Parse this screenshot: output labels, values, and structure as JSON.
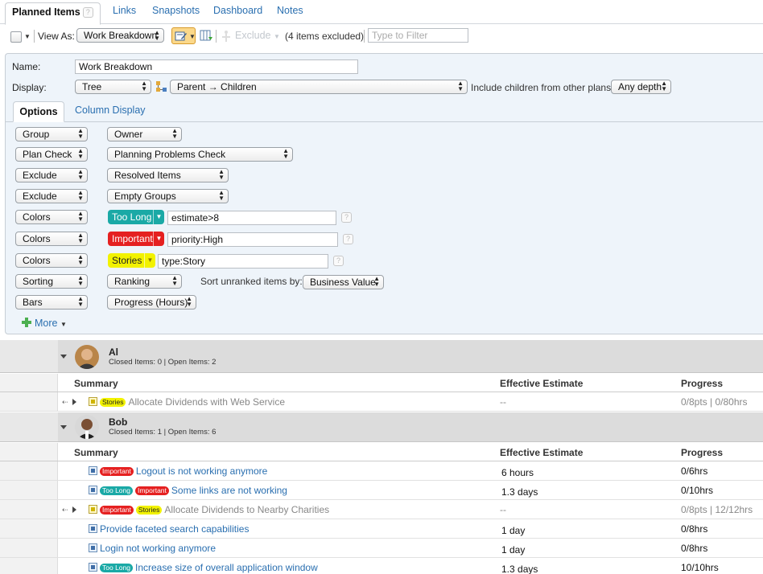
{
  "tabs": {
    "active": "Planned Items",
    "others": [
      "Links",
      "Snapshots",
      "Dashboard",
      "Notes"
    ]
  },
  "toolbar": {
    "view_as_label": "View As:",
    "view_as_value": "Work Breakdown",
    "exclude_label": "Exclude",
    "excluded_count": "(4 items excluded)",
    "filter_placeholder": "Type to Filter"
  },
  "panel": {
    "name_label": "Name:",
    "name_value": "Work Breakdown",
    "display_label": "Display:",
    "display_value": "Tree",
    "relation_value": "Parent → Children",
    "include_label": "Include children from other plans:",
    "include_value": "Any depth",
    "subtabs": [
      "Options",
      "Column Display"
    ],
    "options": [
      {
        "type": "Group",
        "value": "Owner"
      },
      {
        "type": "Plan Check",
        "value": "Planning Problems Check"
      },
      {
        "type": "Exclude",
        "value": "Resolved Items"
      },
      {
        "type": "Exclude",
        "value": "Empty Groups"
      },
      {
        "type": "Colors",
        "chip": "Too Long",
        "chip_color": "#1aa9a6",
        "query": "estimate>8"
      },
      {
        "type": "Colors",
        "chip": "Important",
        "chip_color": "#e52020",
        "query": "priority:High"
      },
      {
        "type": "Colors",
        "chip": "Stories",
        "chip_color": "#f2f200",
        "query": "type:Story"
      },
      {
        "type": "Sorting",
        "value": "Ranking",
        "extra_label": "Sort unranked items by:",
        "extra_value": "Business Value"
      },
      {
        "type": "Bars",
        "value": "Progress (Hours)"
      }
    ],
    "more_label": "More"
  },
  "grid": {
    "columns": [
      "Summary",
      "Effective Estimate",
      "Progress"
    ],
    "groups": [
      {
        "name": "Al",
        "stats": "Closed Items: 0 | Open Items: 2",
        "items": [
          {
            "badges": [
              "Stories"
            ],
            "summary": "Allocate Dividends with Web Service",
            "estimate": "--",
            "progress": "0/8pts | 0/80hrs",
            "dim": true,
            "story": true
          }
        ]
      },
      {
        "name": "Bob",
        "stats": "Closed Items: 1 | Open Items: 6",
        "items": [
          {
            "badges": [
              "Important"
            ],
            "summary": "Logout is not working anymore",
            "estimate": "6 hours",
            "progress": "0/6hrs"
          },
          {
            "badges": [
              "Too Long",
              "Important"
            ],
            "summary": "Some links are not working",
            "estimate": "1.3 days",
            "progress": "0/10hrs"
          },
          {
            "badges": [
              "Important",
              "Stories"
            ],
            "summary": "Allocate Dividends to Nearby Charities",
            "estimate": "--",
            "progress": "0/8pts | 12/12hrs",
            "dim": true,
            "story": true
          },
          {
            "badges": [],
            "summary": "Provide faceted search capabilities",
            "estimate": "1 day",
            "progress": "0/8hrs"
          },
          {
            "badges": [],
            "summary": "Login not working anymore",
            "estimate": "1 day",
            "progress": "0/8hrs"
          },
          {
            "badges": [
              "Too Long"
            ],
            "summary": "Increase size of overall application window",
            "estimate": "1.3 days",
            "progress": "10/10hrs"
          }
        ]
      }
    ]
  }
}
